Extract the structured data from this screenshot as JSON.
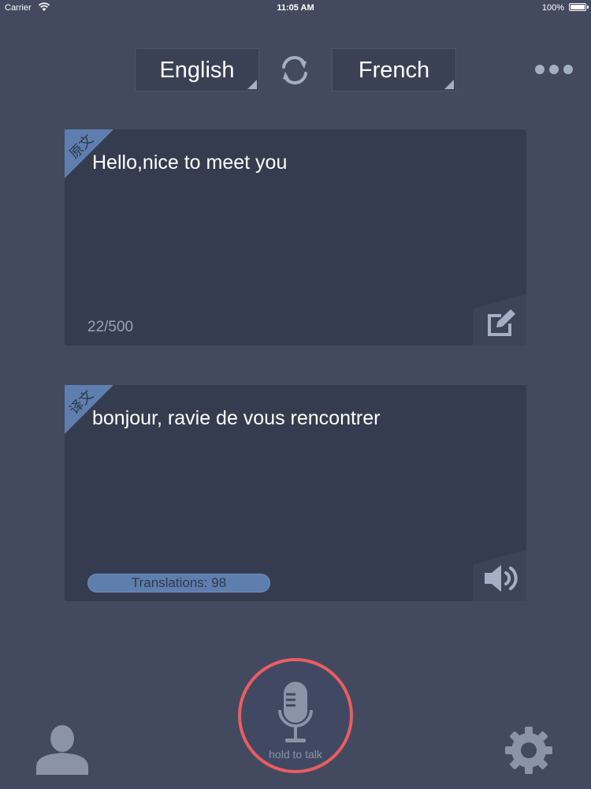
{
  "status_bar": {
    "carrier": "Carrier",
    "time": "11:05 AM",
    "battery": "100%"
  },
  "language_bar": {
    "source_language": "English",
    "target_language": "French"
  },
  "source_card": {
    "badge": "原文",
    "text": "Hello,nice to meet you",
    "char_count": "22/500"
  },
  "target_card": {
    "badge": "译文",
    "text": "bonjour, ravie de vous rencontrer",
    "translations_label": "Translations: 98"
  },
  "mic": {
    "label": "hold to talk"
  },
  "colors": {
    "background": "#434a5f",
    "card": "#363c4f",
    "accent_blue": "#5e7fae",
    "mic_ring": "#ea5d62",
    "icon_gray": "#a3afc4"
  },
  "icons": {
    "swap": "swap-arrows-icon",
    "more": "more-dots-icon",
    "edit": "edit-icon",
    "speaker": "speaker-icon",
    "mic": "microphone-icon",
    "user": "user-icon",
    "settings": "gear-icon"
  }
}
